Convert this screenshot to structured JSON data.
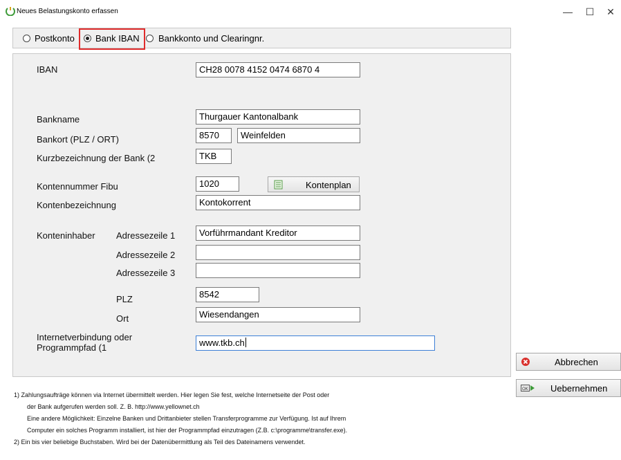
{
  "window": {
    "title": "Neues Belastungskonto erfassen",
    "controls": {
      "minimize": "—",
      "maximize": "☐",
      "close": "✕"
    }
  },
  "account_type": {
    "options": [
      {
        "label": "Postkonto",
        "selected": false
      },
      {
        "label": "Bank IBAN",
        "selected": true
      },
      {
        "label": "Bankkonto und Clearingnr.",
        "selected": false
      }
    ]
  },
  "form": {
    "iban": {
      "label": "IBAN",
      "value": "CH28 0078 4152 0474 6870 4"
    },
    "bankname": {
      "label": "Bankname",
      "value": "Thurgauer Kantonalbank"
    },
    "bankort": {
      "label": "Bankort (PLZ / ORT)",
      "plz": "8570",
      "ort": "Weinfelden"
    },
    "kurz": {
      "label": "Kurzbezeichnung der Bank (2",
      "value": "TKB"
    },
    "konto_fibu": {
      "label": "Kontennummer Fibu",
      "value": "1020"
    },
    "kontenplan_button": "Kontenplan",
    "kontenbez": {
      "label": "Kontenbezeichnung",
      "value": "Kontokorrent"
    },
    "inhaber": {
      "label": "Konteninhaber",
      "adr1_label": "Adressezeile 1",
      "adr1": "Vorführmandant Kreditor",
      "adr2_label": "Adressezeile 2",
      "adr2": "",
      "adr3_label": "Adressezeile 3",
      "adr3": "",
      "plz_label": "PLZ",
      "plz": "8542",
      "ort_label": "Ort",
      "ort": "Wiesendangen"
    },
    "internet": {
      "label_line1": "Internetverbindung oder",
      "label_line2": "Programmpfad (1",
      "value": "www.tkb.ch"
    }
  },
  "buttons": {
    "cancel": "Abbrechen",
    "apply": "Uebernehmen"
  },
  "footnotes": [
    "1)  Zahlungsaufträge können via Internet übermittelt werden. Hier legen Sie fest, welche Internetseite der Post oder",
    "der Bank aufgerufen werden soll. Z. B. http://www.yellownet.ch",
    "Eine andere Möglichkeit: Einzelne Banken und Drittanbieter stellen Transferprogramme zur Verfügung. Ist auf Ihrem",
    "Computer ein solches Programm installiert, ist hier der Programmpfad einzutragen (Z.B. c:\\programme\\transfer.exe).",
    "2)  Ein bis vier beliebige Buchstaben. Wird bei der Datenübermittlung als Teil des Dateinamens verwendet."
  ],
  "colors": {
    "highlight": "#e02b2b",
    "focus": "#3c7fd6",
    "panel": "#f0f0f0"
  }
}
